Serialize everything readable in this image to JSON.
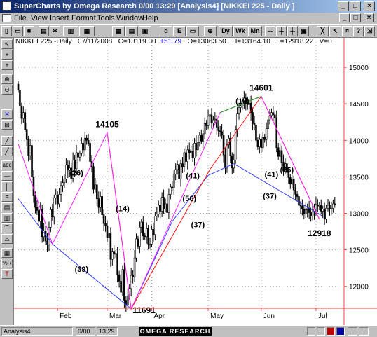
{
  "window": {
    "title": "SuperCharts by Omega Research 0/00 13:29 [Analysis4] [NIKKEI 225 - Daily ]",
    "controls": [
      "_",
      "□",
      "×"
    ]
  },
  "menu": {
    "items": [
      "File",
      "View",
      "Insert",
      "Format",
      "Tools",
      "Window",
      "Help"
    ],
    "doc_controls": [
      "_",
      "□",
      "×"
    ]
  },
  "toolbar": {
    "left_buttons": [
      "new",
      "open",
      "save",
      "print-preview",
      "cut",
      "copy",
      "paste",
      "format-bars",
      "insert-indicator",
      "data",
      "ez-data",
      "toggle"
    ],
    "interval_buttons": [
      "Dy",
      "Wk",
      "Mn"
    ],
    "right_buttons": [
      "bars-up",
      "bars-down",
      "zoom-in",
      "zoom-out",
      "chart",
      "grid",
      "cursor",
      "link",
      "help",
      "exit"
    ]
  },
  "drawing_tools": [
    "pointer",
    "crosshair",
    "zoom-in",
    "zoom-out",
    "delete",
    "trendline",
    "fibonacci",
    "text",
    "horizontal-line",
    "vertical-line",
    "channel",
    "speed-lines",
    "arc",
    "cycle",
    "percent-retracement",
    "gann"
  ],
  "info_line": {
    "symbol": "NIKKEI 225 -Daily",
    "date": "07/11/2008",
    "close": "C=13119.00",
    "change": "+51.79",
    "open": "O=13063.50",
    "high": "H=13164.10",
    "low": "L=12918.22",
    "volume": "V=0"
  },
  "status": {
    "analysis": "Analysis4",
    "position": "0/00",
    "time": "13:29",
    "brand": "OMEGA RESEARCH"
  },
  "chart_data": {
    "type": "candlestick",
    "y_range": [
      11700,
      15250
    ],
    "y_ticks": [
      12000,
      12500,
      13000,
      13500,
      14000,
      14500,
      15000
    ],
    "x_labels": [
      "Feb",
      "Mar",
      "Apr",
      "May",
      "Jun",
      "Jul"
    ],
    "x_label_days": [
      23,
      52,
      78,
      111,
      142,
      174
    ],
    "day_range": [
      0,
      190
    ],
    "closes": [
      14690,
      14470,
      14300,
      14380,
      14150,
      14010,
      13790,
      13930,
      13500,
      13240,
      13080,
      13040,
      12890,
      13050,
      12680,
      12760,
      12620,
      12570,
      12810,
      13050,
      12950,
      13210,
      13250,
      13130,
      13260,
      13380,
      13420,
      13470,
      13660,
      13590,
      13620,
      13480,
      13730,
      13610,
      13830,
      13770,
      13820,
      13960,
      13870,
      14030,
      14000,
      13960,
      13710,
      13640,
      13330,
      13390,
      13200,
      13080,
      13230,
      12980,
      12860,
      12830,
      12670,
      12730,
      12370,
      12480,
      12440,
      12450,
      12160,
      12070,
      11920,
      12230,
      11810,
      11740,
      11870,
      11970,
      12150,
      12130,
      12390,
      12650,
      12550,
      12810,
      12880,
      12690,
      12680,
      12790,
      12580,
      12580,
      12780,
      12710,
      12960,
      12990,
      13110,
      13030,
      13220,
      13060,
      13130,
      13010,
      13260,
      13360,
      13350,
      13540,
      13600,
      13670,
      13470,
      13680,
      13640,
      13830,
      13710,
      13870,
      13830,
      13850,
      13760,
      13960,
      13870,
      13970,
      14070,
      13990,
      14090,
      14230,
      14200,
      14330,
      14350,
      14240,
      14280,
      14290,
      14180,
      14130,
      14120,
      14070,
      13800,
      13620,
      13940,
      14030,
      13790,
      13620,
      13730,
      14150,
      14370,
      14450,
      14470,
      14540,
      14580,
      14500,
      14490,
      14510,
      14380,
      14230,
      14210,
      14000,
      13910,
      14010,
      13900,
      14040,
      14010,
      14160,
      14280,
      14340,
      14380,
      14350,
      14310,
      13900,
      13780,
      13860,
      13700,
      13580,
      13680,
      13560,
      13490,
      13400,
      13470,
      13320,
      13260,
      13230,
      13110,
      13100,
      13060,
      12990,
      13050,
      13070,
      13010,
      12960,
      13020,
      13060,
      13120,
      13100,
      13110,
      13030,
      13060,
      12920,
      13070,
      13110,
      13060,
      13070,
      13130,
      13120
    ],
    "waves": {
      "blue": [
        [
          0,
          13200
        ],
        [
          20,
          12580
        ],
        [
          66,
          11691
        ],
        [
          90,
          12890
        ],
        [
          111,
          13520
        ],
        [
          126,
          13680
        ],
        [
          178,
          12960
        ]
      ],
      "red": [
        [
          52,
          14105
        ],
        [
          66,
          11691
        ],
        [
          112,
          13600
        ],
        [
          142,
          14601
        ],
        [
          176,
          12918
        ]
      ],
      "magenta": [
        [
          0,
          13950
        ],
        [
          20,
          12580
        ],
        [
          52,
          14105
        ],
        [
          66,
          11691
        ],
        [
          118,
          14380
        ],
        [
          142,
          14601
        ],
        [
          176,
          12918
        ]
      ],
      "green": [
        [
          118,
          14380
        ],
        [
          142,
          14601
        ]
      ]
    },
    "peak_labels": [
      {
        "text": "14105",
        "day": 52,
        "price": 14105,
        "pos": "above"
      },
      {
        "text": "14601",
        "day": 142,
        "price": 14601,
        "pos": "above"
      },
      {
        "text": "11691",
        "day": 66,
        "price": 11691,
        "pos": "right"
      },
      {
        "text": "12918",
        "day": 176,
        "price": 12918,
        "pos": "below"
      }
    ],
    "annotations": [
      {
        "text": "(26)",
        "day": 34,
        "price": 13520
      },
      {
        "text": "(14)",
        "day": 61,
        "price": 13030
      },
      {
        "text": "(39)",
        "day": 37,
        "price": 12200
      },
      {
        "text": "(41)",
        "day": 102,
        "price": 13480
      },
      {
        "text": "(56)",
        "day": 100,
        "price": 13170
      },
      {
        "text": "(37)",
        "day": 105,
        "price": 12810
      },
      {
        "text": "(16)",
        "day": 131,
        "price": 14500
      },
      {
        "text": "(41)",
        "day": 148,
        "price": 13500
      },
      {
        "text": "(26)",
        "day": 157,
        "price": 13560
      },
      {
        "text": "(37)",
        "day": 147,
        "price": 13200
      }
    ]
  }
}
